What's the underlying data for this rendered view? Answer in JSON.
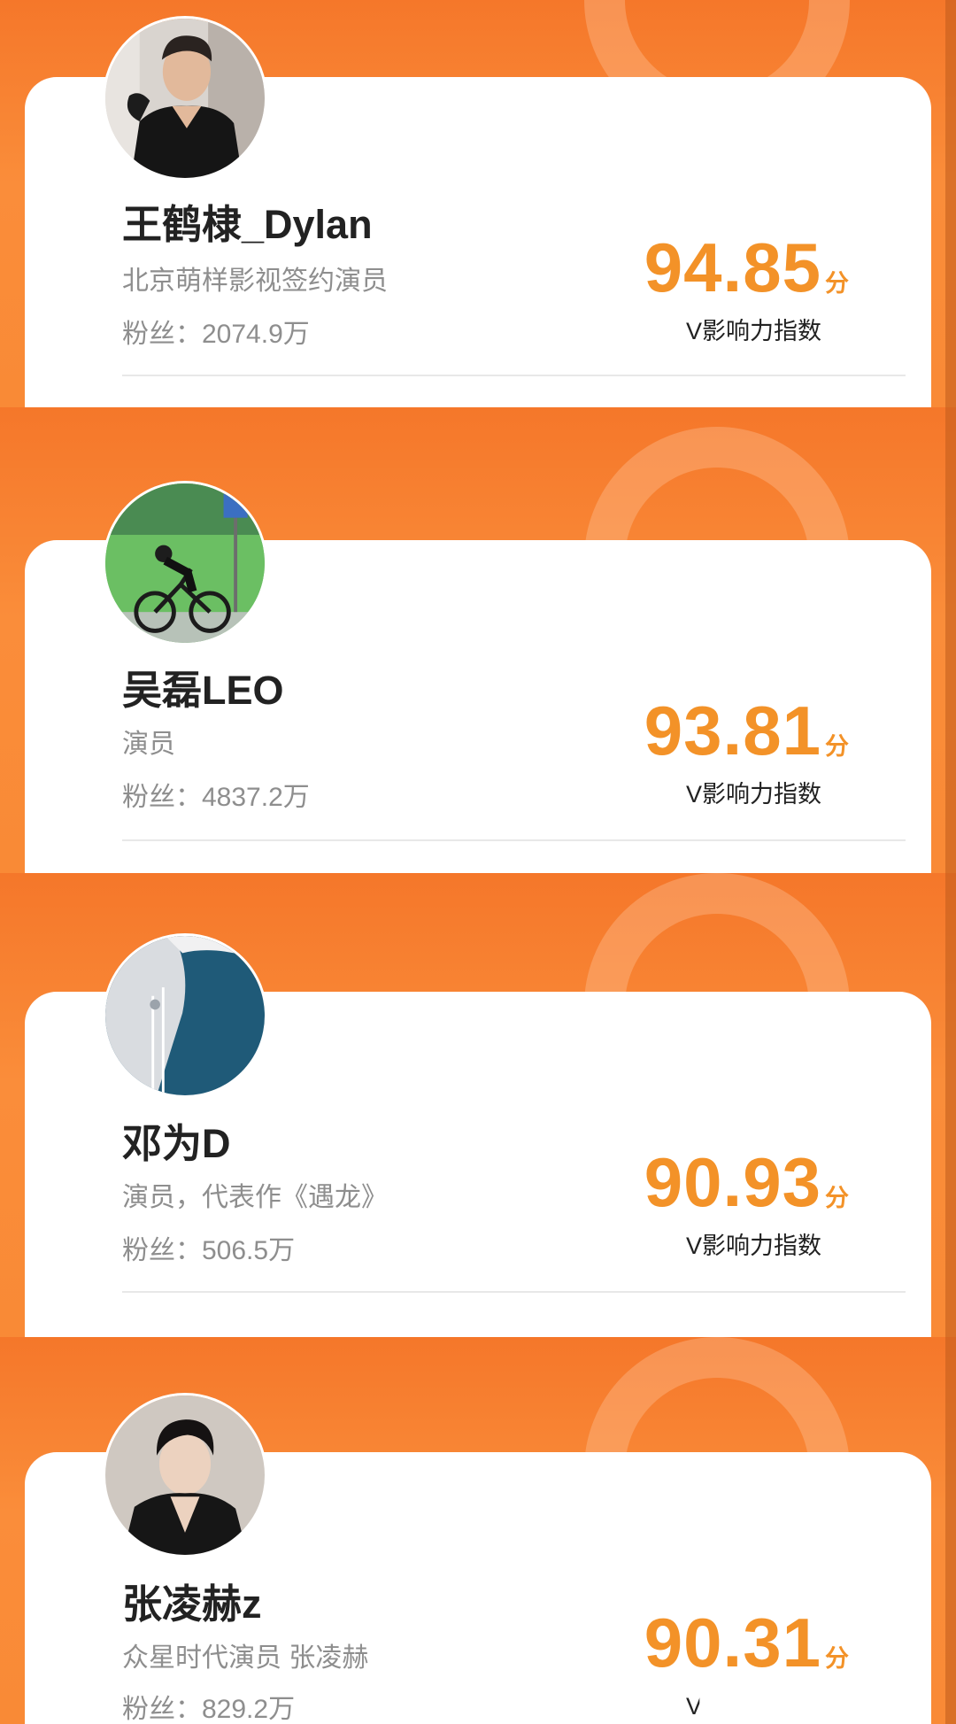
{
  "cards": [
    {
      "name": "王鹤棣_Dylan",
      "description": "北京萌样影视签约演员",
      "fans_label": "粉丝：",
      "fans_value": "2074.9万",
      "score": "94.85",
      "score_unit": "分",
      "index_label": "V影响力指数"
    },
    {
      "name": "吴磊LEO",
      "description": "演员",
      "fans_label": "粉丝：",
      "fans_value": "4837.2万",
      "score": "93.81",
      "score_unit": "分",
      "index_label": "V影响力指数"
    },
    {
      "name": "邓为D",
      "description": "演员，代表作《遇龙》",
      "fans_label": "粉丝：",
      "fans_value": "506.5万",
      "score": "90.93",
      "score_unit": "分",
      "index_label": "V影响力指数"
    },
    {
      "name": "张凌赫z",
      "description": "众星时代演员 张凌赫",
      "fans_label": "粉丝：",
      "fans_value": "829.2万",
      "score": "90.31",
      "score_unit": "分",
      "index_label": "V影响力指数"
    }
  ],
  "theme": {
    "background_orange": "#f7892f",
    "score_orange": "#f39228",
    "name_color": "#222222",
    "secondary_text": "#8e8e8e"
  },
  "icons": [
    "avatar-dylan",
    "avatar-leo",
    "avatar-dengwei",
    "avatar-zhanglinghe"
  ]
}
